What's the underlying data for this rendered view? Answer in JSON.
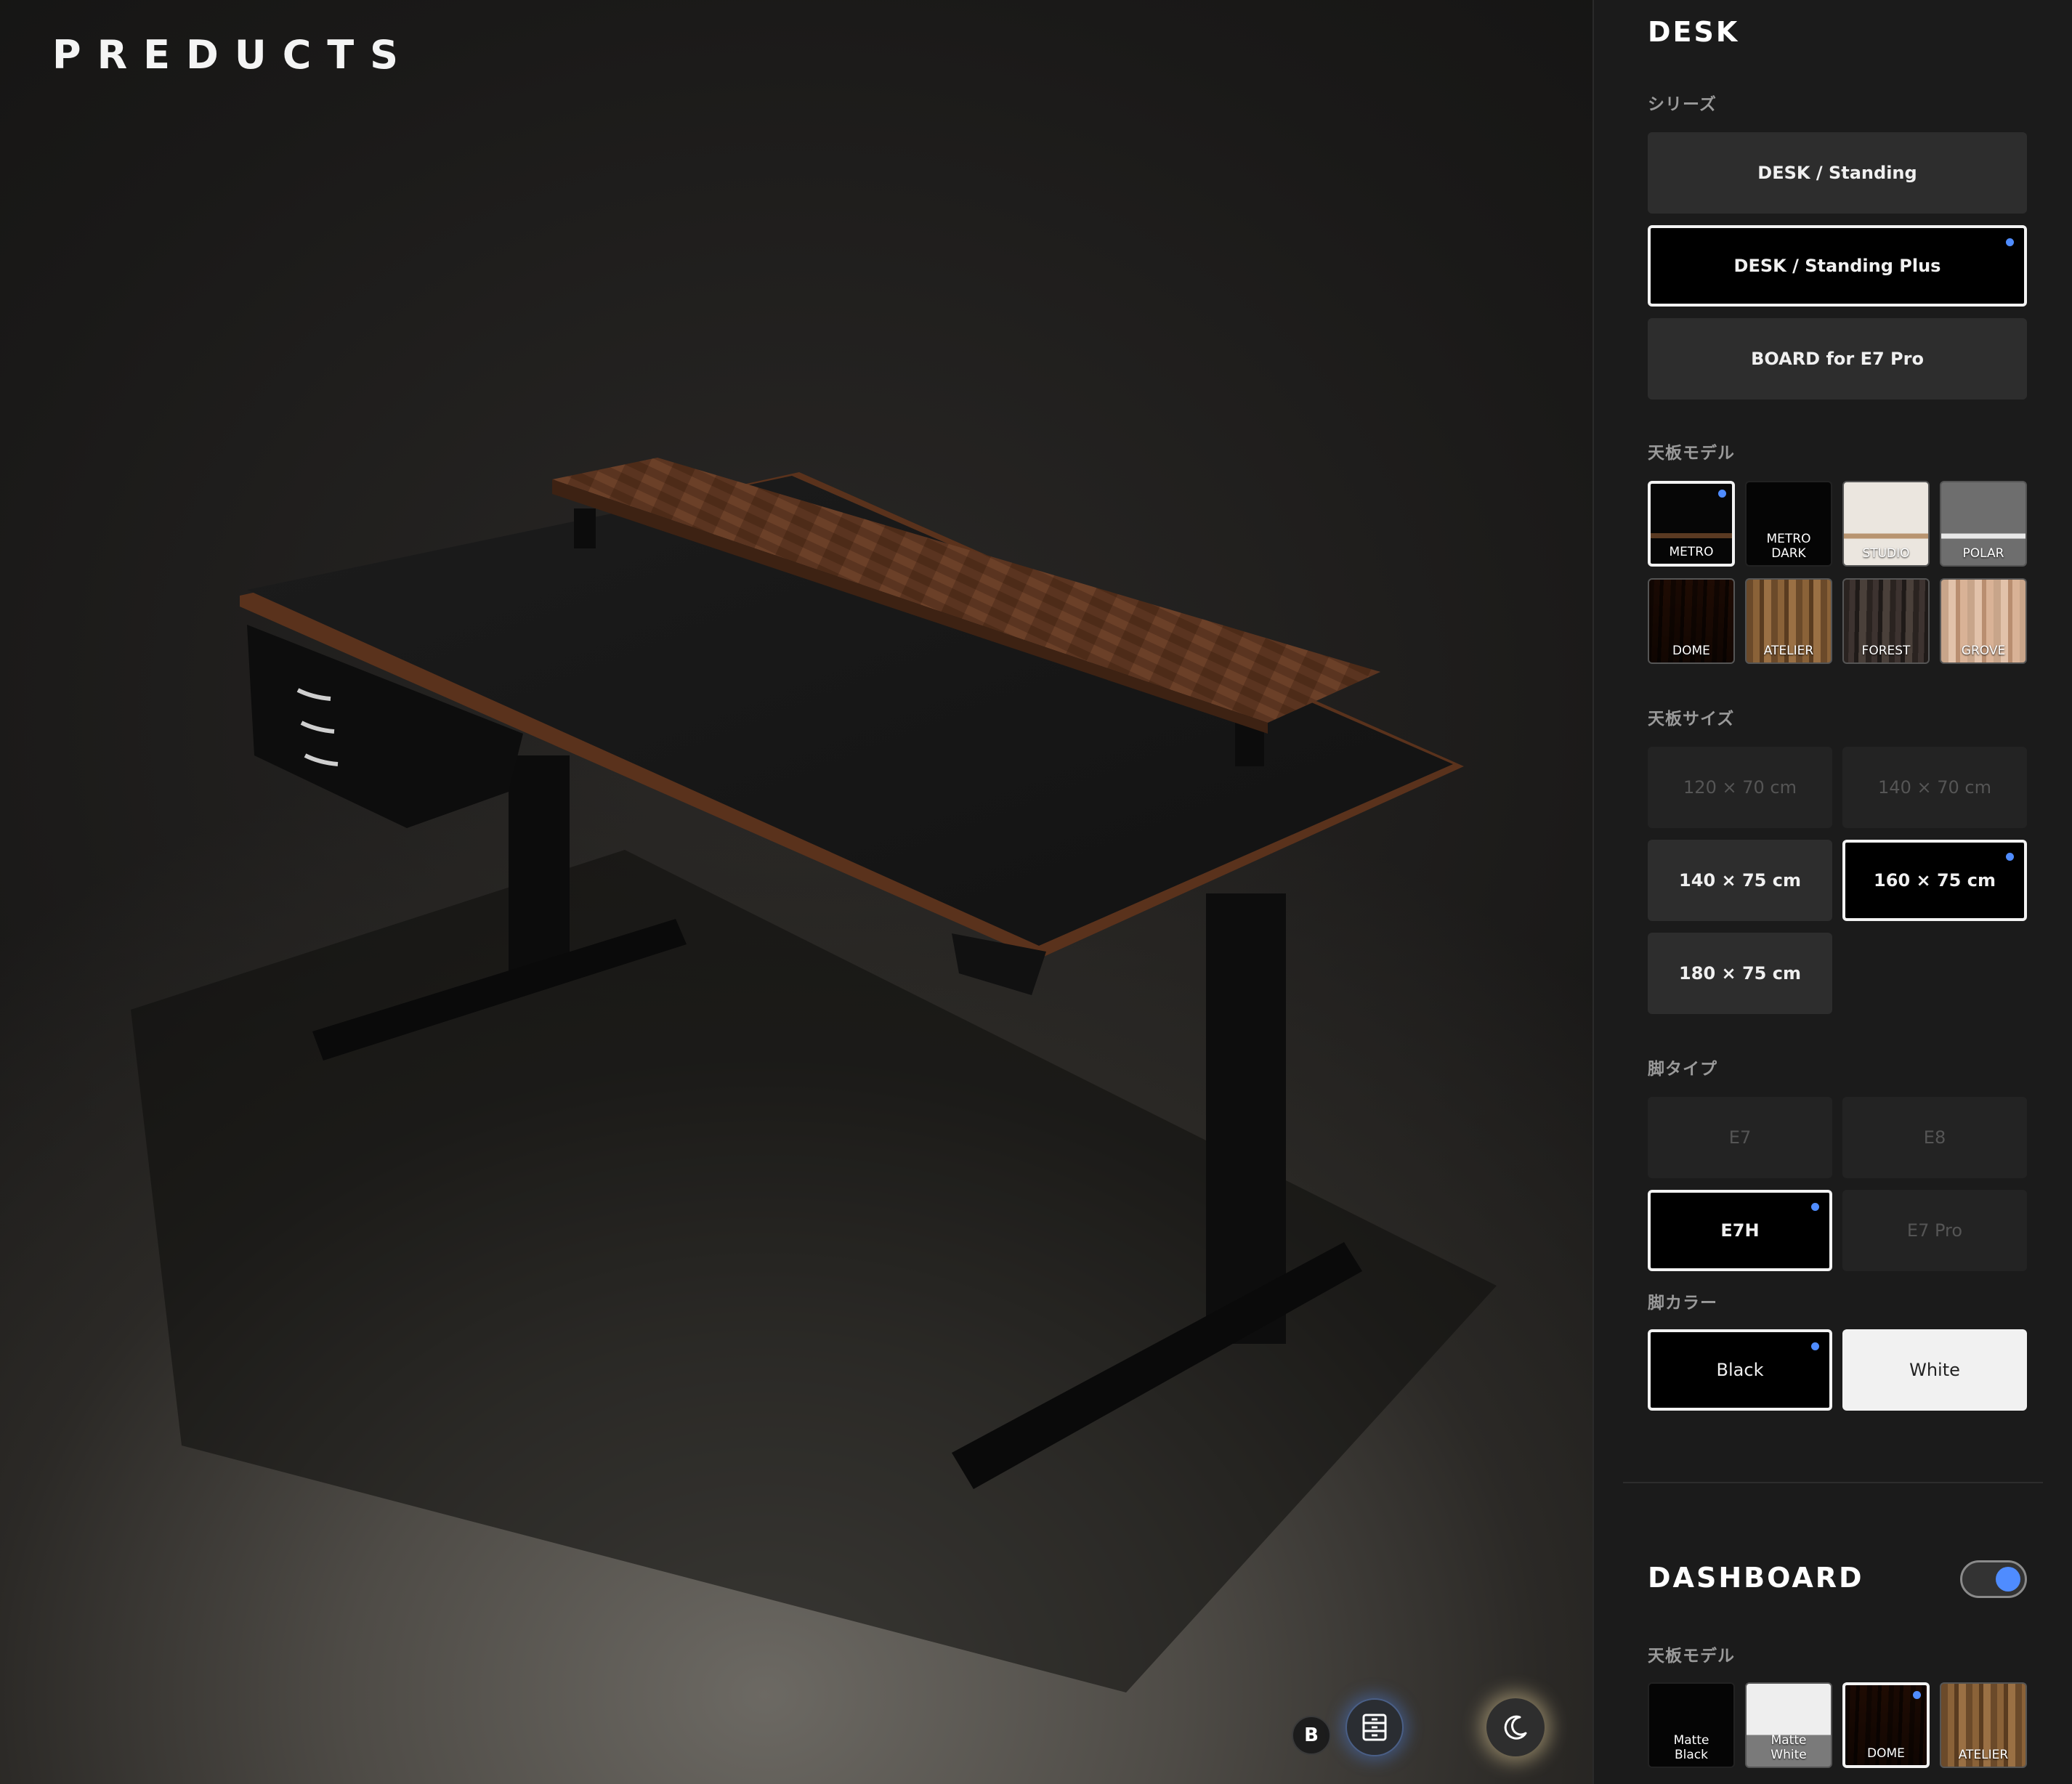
{
  "brand": "PREDUCTS",
  "viewport": {
    "badge_label": "B",
    "drawer_icon": "drawer-icon",
    "theme_icon": "moon-icon"
  },
  "desk": {
    "title": "DESK",
    "series": {
      "label": "シリーズ",
      "options": [
        "DESK / Standing",
        "DESK / Standing Plus",
        "BOARD for E7 Pro"
      ],
      "selected": "DESK / Standing Plus"
    },
    "top_model": {
      "label": "天板モデル",
      "options": [
        {
          "line1": "METRO",
          "line2": ""
        },
        {
          "line1": "METRO",
          "line2": "DARK"
        },
        {
          "line1": "STUDIO",
          "line2": ""
        },
        {
          "line1": "POLAR",
          "line2": ""
        },
        {
          "line1": "DOME",
          "line2": ""
        },
        {
          "line1": "ATELIER",
          "line2": ""
        },
        {
          "line1": "FOREST",
          "line2": ""
        },
        {
          "line1": "GROVE",
          "line2": ""
        }
      ],
      "selected": "METRO"
    },
    "top_size": {
      "label": "天板サイズ",
      "options": [
        "120 × 70 cm",
        "140 × 70 cm",
        "140 × 75 cm",
        "160 × 75 cm",
        "180 × 75 cm"
      ],
      "selected": "160 × 75 cm"
    },
    "leg_type": {
      "label": "脚タイプ",
      "options": [
        "E7",
        "E8",
        "E7H",
        "E7 Pro"
      ],
      "selected": "E7H"
    },
    "leg_color": {
      "label": "脚カラー",
      "options": [
        "Black",
        "White"
      ],
      "selected": "Black"
    }
  },
  "dashboard": {
    "title": "DASHBOARD",
    "enabled": true,
    "top_model": {
      "label": "天板モデル",
      "options": [
        {
          "line1": "Matte",
          "line2": "Black"
        },
        {
          "line1": "Matte",
          "line2": "White"
        },
        {
          "line1": "DOME",
          "line2": ""
        },
        {
          "line1": "ATELIER",
          "line2": ""
        }
      ],
      "selected": "DOME"
    }
  },
  "colors": {
    "accent": "#4f8cff",
    "panel_bg": "#1b1b1b",
    "option_bg": "#2d2d2d"
  }
}
